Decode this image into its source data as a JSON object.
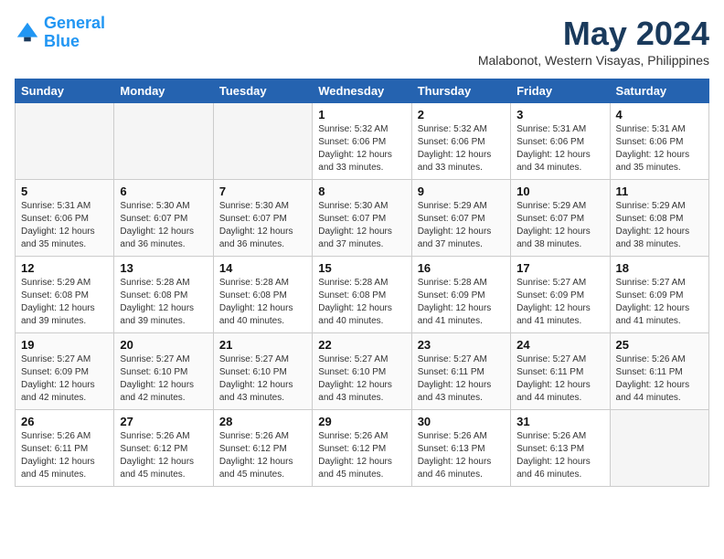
{
  "header": {
    "logo_line1": "General",
    "logo_line2": "Blue",
    "month": "May 2024",
    "location": "Malabonot, Western Visayas, Philippines"
  },
  "weekdays": [
    "Sunday",
    "Monday",
    "Tuesday",
    "Wednesday",
    "Thursday",
    "Friday",
    "Saturday"
  ],
  "weeks": [
    [
      {
        "day": "",
        "info": "",
        "empty": true
      },
      {
        "day": "",
        "info": "",
        "empty": true
      },
      {
        "day": "",
        "info": "",
        "empty": true
      },
      {
        "day": "1",
        "info": "Sunrise: 5:32 AM\nSunset: 6:06 PM\nDaylight: 12 hours\nand 33 minutes.",
        "empty": false
      },
      {
        "day": "2",
        "info": "Sunrise: 5:32 AM\nSunset: 6:06 PM\nDaylight: 12 hours\nand 33 minutes.",
        "empty": false
      },
      {
        "day": "3",
        "info": "Sunrise: 5:31 AM\nSunset: 6:06 PM\nDaylight: 12 hours\nand 34 minutes.",
        "empty": false
      },
      {
        "day": "4",
        "info": "Sunrise: 5:31 AM\nSunset: 6:06 PM\nDaylight: 12 hours\nand 35 minutes.",
        "empty": false
      }
    ],
    [
      {
        "day": "5",
        "info": "Sunrise: 5:31 AM\nSunset: 6:06 PM\nDaylight: 12 hours\nand 35 minutes.",
        "empty": false
      },
      {
        "day": "6",
        "info": "Sunrise: 5:30 AM\nSunset: 6:07 PM\nDaylight: 12 hours\nand 36 minutes.",
        "empty": false
      },
      {
        "day": "7",
        "info": "Sunrise: 5:30 AM\nSunset: 6:07 PM\nDaylight: 12 hours\nand 36 minutes.",
        "empty": false
      },
      {
        "day": "8",
        "info": "Sunrise: 5:30 AM\nSunset: 6:07 PM\nDaylight: 12 hours\nand 37 minutes.",
        "empty": false
      },
      {
        "day": "9",
        "info": "Sunrise: 5:29 AM\nSunset: 6:07 PM\nDaylight: 12 hours\nand 37 minutes.",
        "empty": false
      },
      {
        "day": "10",
        "info": "Sunrise: 5:29 AM\nSunset: 6:07 PM\nDaylight: 12 hours\nand 38 minutes.",
        "empty": false
      },
      {
        "day": "11",
        "info": "Sunrise: 5:29 AM\nSunset: 6:08 PM\nDaylight: 12 hours\nand 38 minutes.",
        "empty": false
      }
    ],
    [
      {
        "day": "12",
        "info": "Sunrise: 5:29 AM\nSunset: 6:08 PM\nDaylight: 12 hours\nand 39 minutes.",
        "empty": false
      },
      {
        "day": "13",
        "info": "Sunrise: 5:28 AM\nSunset: 6:08 PM\nDaylight: 12 hours\nand 39 minutes.",
        "empty": false
      },
      {
        "day": "14",
        "info": "Sunrise: 5:28 AM\nSunset: 6:08 PM\nDaylight: 12 hours\nand 40 minutes.",
        "empty": false
      },
      {
        "day": "15",
        "info": "Sunrise: 5:28 AM\nSunset: 6:08 PM\nDaylight: 12 hours\nand 40 minutes.",
        "empty": false
      },
      {
        "day": "16",
        "info": "Sunrise: 5:28 AM\nSunset: 6:09 PM\nDaylight: 12 hours\nand 41 minutes.",
        "empty": false
      },
      {
        "day": "17",
        "info": "Sunrise: 5:27 AM\nSunset: 6:09 PM\nDaylight: 12 hours\nand 41 minutes.",
        "empty": false
      },
      {
        "day": "18",
        "info": "Sunrise: 5:27 AM\nSunset: 6:09 PM\nDaylight: 12 hours\nand 41 minutes.",
        "empty": false
      }
    ],
    [
      {
        "day": "19",
        "info": "Sunrise: 5:27 AM\nSunset: 6:09 PM\nDaylight: 12 hours\nand 42 minutes.",
        "empty": false
      },
      {
        "day": "20",
        "info": "Sunrise: 5:27 AM\nSunset: 6:10 PM\nDaylight: 12 hours\nand 42 minutes.",
        "empty": false
      },
      {
        "day": "21",
        "info": "Sunrise: 5:27 AM\nSunset: 6:10 PM\nDaylight: 12 hours\nand 43 minutes.",
        "empty": false
      },
      {
        "day": "22",
        "info": "Sunrise: 5:27 AM\nSunset: 6:10 PM\nDaylight: 12 hours\nand 43 minutes.",
        "empty": false
      },
      {
        "day": "23",
        "info": "Sunrise: 5:27 AM\nSunset: 6:11 PM\nDaylight: 12 hours\nand 43 minutes.",
        "empty": false
      },
      {
        "day": "24",
        "info": "Sunrise: 5:27 AM\nSunset: 6:11 PM\nDaylight: 12 hours\nand 44 minutes.",
        "empty": false
      },
      {
        "day": "25",
        "info": "Sunrise: 5:26 AM\nSunset: 6:11 PM\nDaylight: 12 hours\nand 44 minutes.",
        "empty": false
      }
    ],
    [
      {
        "day": "26",
        "info": "Sunrise: 5:26 AM\nSunset: 6:11 PM\nDaylight: 12 hours\nand 45 minutes.",
        "empty": false
      },
      {
        "day": "27",
        "info": "Sunrise: 5:26 AM\nSunset: 6:12 PM\nDaylight: 12 hours\nand 45 minutes.",
        "empty": false
      },
      {
        "day": "28",
        "info": "Sunrise: 5:26 AM\nSunset: 6:12 PM\nDaylight: 12 hours\nand 45 minutes.",
        "empty": false
      },
      {
        "day": "29",
        "info": "Sunrise: 5:26 AM\nSunset: 6:12 PM\nDaylight: 12 hours\nand 45 minutes.",
        "empty": false
      },
      {
        "day": "30",
        "info": "Sunrise: 5:26 AM\nSunset: 6:13 PM\nDaylight: 12 hours\nand 46 minutes.",
        "empty": false
      },
      {
        "day": "31",
        "info": "Sunrise: 5:26 AM\nSunset: 6:13 PM\nDaylight: 12 hours\nand 46 minutes.",
        "empty": false
      },
      {
        "day": "",
        "info": "",
        "empty": true
      }
    ]
  ]
}
